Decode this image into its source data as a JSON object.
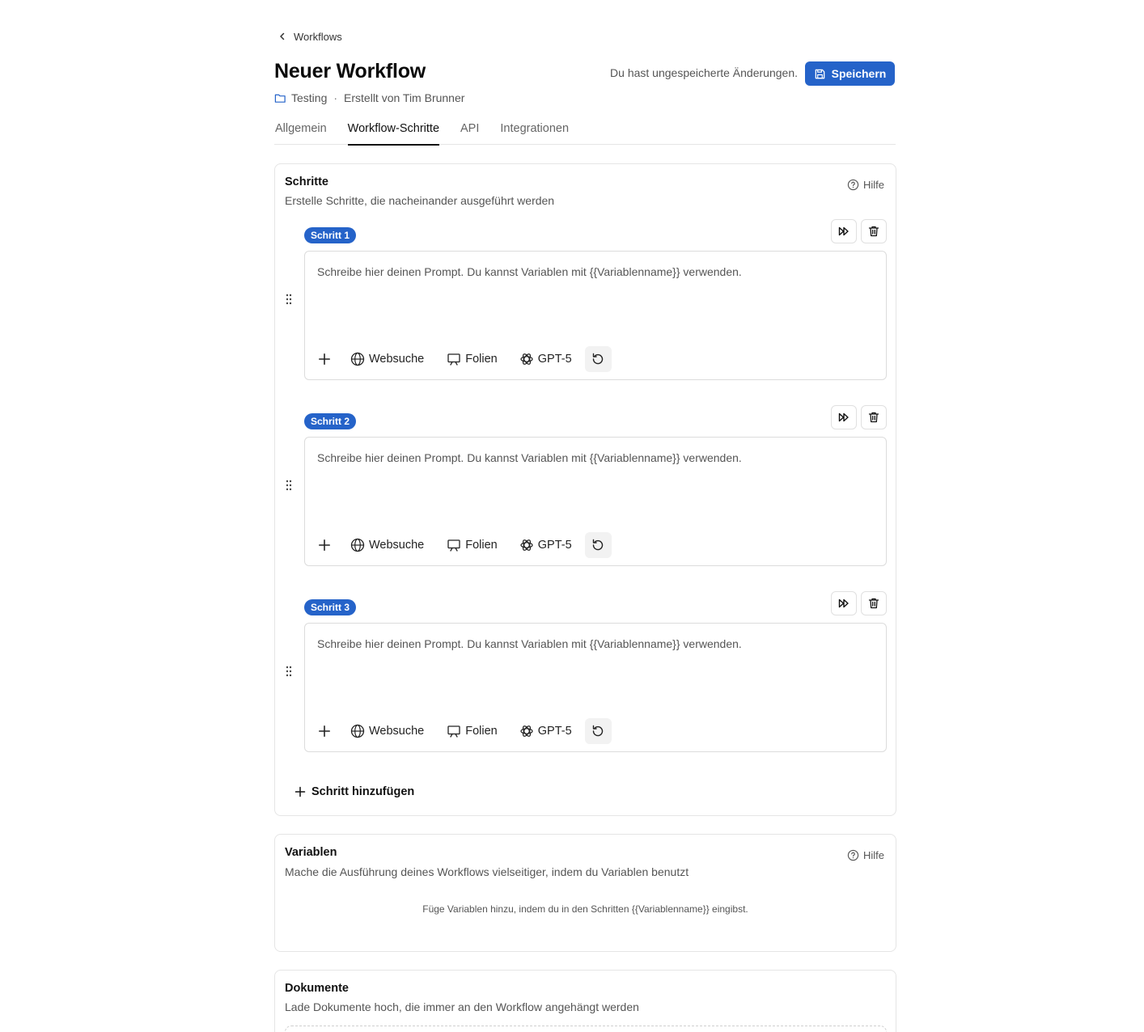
{
  "nav": {
    "back_label": "Workflows"
  },
  "header": {
    "title": "Neuer Workflow",
    "folder": "Testing",
    "separator": "·",
    "created_by": "Erstellt von Tim Brunner",
    "unsaved_notice": "Du hast ungespeicherte Änderungen.",
    "save_label": "Speichern"
  },
  "tabs": [
    {
      "label": "Allgemein",
      "active": false
    },
    {
      "label": "Workflow-Schritte",
      "active": true
    },
    {
      "label": "API",
      "active": false
    },
    {
      "label": "Integrationen",
      "active": false
    }
  ],
  "steps_section": {
    "title": "Schritte",
    "subtitle": "Erstelle Schritte, die nacheinander ausgeführt werden",
    "help_label": "Hilfe",
    "add_step_label": "Schritt hinzufügen",
    "steps": [
      {
        "badge": "Schritt 1",
        "placeholder": "Schreibe hier deinen Prompt. Du kannst Variablen mit {{Variablenname}} verwenden.",
        "web_label": "Websuche",
        "slides_label": "Folien",
        "model_label": "GPT-5"
      },
      {
        "badge": "Schritt 2",
        "placeholder": "Schreibe hier deinen Prompt. Du kannst Variablen mit {{Variablenname}} verwenden.",
        "web_label": "Websuche",
        "slides_label": "Folien",
        "model_label": "GPT-5"
      },
      {
        "badge": "Schritt 3",
        "placeholder": "Schreibe hier deinen Prompt. Du kannst Variablen mit {{Variablenname}} verwenden.",
        "web_label": "Websuche",
        "slides_label": "Folien",
        "model_label": "GPT-5"
      }
    ]
  },
  "variables_section": {
    "title": "Variablen",
    "subtitle": "Mache die Ausführung deines Workflows vielseitiger, indem du Variablen benutzt",
    "help_label": "Hilfe",
    "empty_hint": "Füge Variablen hinzu, indem du in den Schritten {{Variablenname}} eingibst."
  },
  "documents_section": {
    "title": "Dokumente",
    "subtitle": "Lade Dokumente hoch, die immer an den Workflow angehängt werden"
  },
  "colors": {
    "accent": "#2563c9",
    "border": "#e5e5e5",
    "muted_text": "#555555"
  }
}
